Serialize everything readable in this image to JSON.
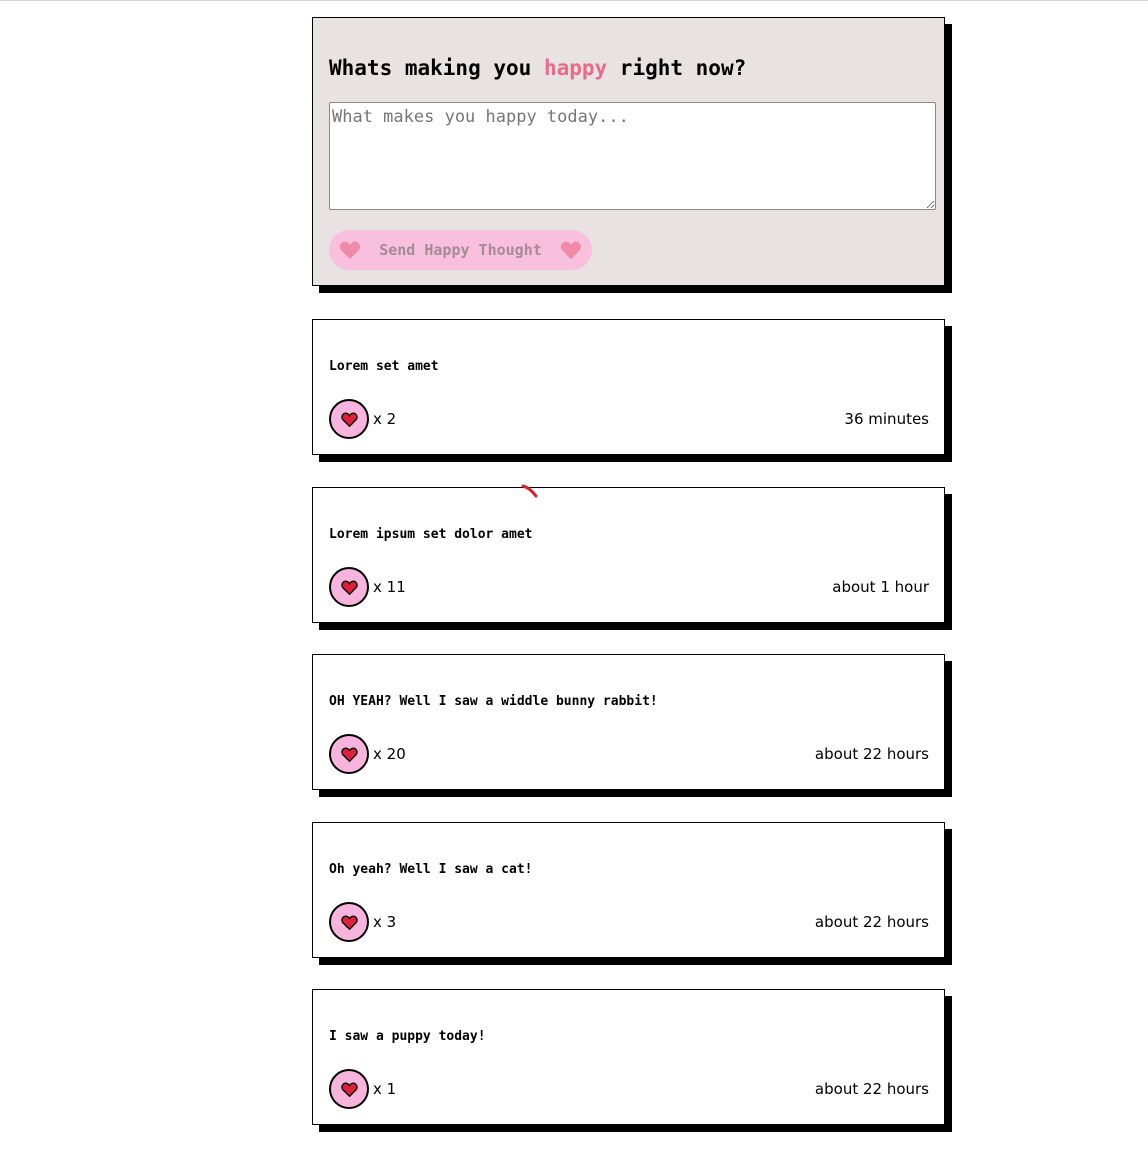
{
  "form": {
    "title_before": "Whats making you ",
    "title_accent": "happy",
    "title_after": " right now?",
    "input_value": "",
    "input_placeholder": "What makes you happy today...",
    "send_label": "Send Happy Thought",
    "heart_icon": "heart-icon"
  },
  "messages": [
    {
      "text": "Lorem set amet",
      "likes_label": "x 2",
      "time": "36 minutes"
    },
    {
      "text": "Lorem ipsum set dolor amet",
      "likes_label": "x 11",
      "time": "about 1 hour"
    },
    {
      "text": "OH YEAH? Well I saw a widdle bunny rabbit!",
      "likes_label": "x 20",
      "time": "about 22 hours"
    },
    {
      "text": "Oh yeah? Well I saw a cat!",
      "likes_label": "x 3",
      "time": "about 22 hours"
    },
    {
      "text": "I saw a puppy today!",
      "likes_label": "x 1",
      "time": "about 22 hours"
    }
  ],
  "colors": {
    "accent": "#ea6a8a",
    "form_background": "#e8e3e2",
    "button_pink": "#f8c0dc",
    "like_pink": "#f8b4dc",
    "heart_red": "#e0203a",
    "shadow": "#000000"
  }
}
